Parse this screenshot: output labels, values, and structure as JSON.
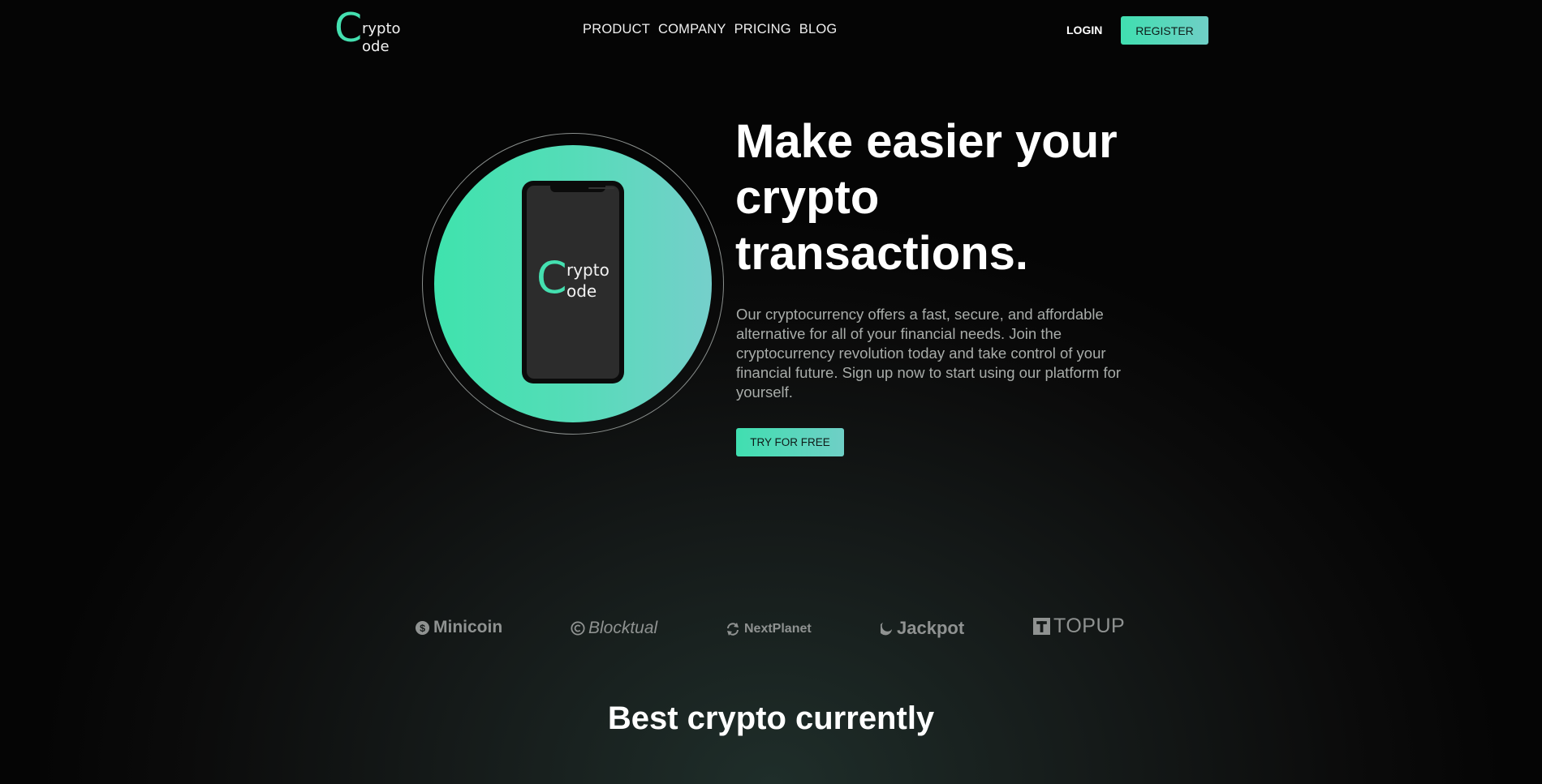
{
  "header": {
    "logo": {
      "big_letter": "C",
      "line1": "rypto",
      "line2": "ode"
    },
    "nav": [
      {
        "label": "PRODUCT"
      },
      {
        "label": "COMPANY"
      },
      {
        "label": "PRICING"
      },
      {
        "label": "BLOG"
      }
    ],
    "login_label": "LOGIN",
    "register_label": "REGISTER"
  },
  "hero": {
    "phone_logo": {
      "big_letter": "C",
      "line1": "rypto",
      "line2": "ode"
    },
    "title_lines": [
      "Make easier your",
      "crypto",
      "transactions."
    ],
    "description": "Our cryptocurrency offers a fast, secure, and affordable alternative for all of your financial needs. Join the cryptocurrency revolution today and take control of your financial future. Sign up now to start using our platform for yourself.",
    "cta_label": "TRY FOR FREE"
  },
  "partners": [
    {
      "name": "Minicoin",
      "icon": "dollar-coin-icon"
    },
    {
      "name": "Blocktual",
      "icon": "copyright-circle-icon"
    },
    {
      "name": "NextPlanet",
      "icon": "refresh-cycle-icon"
    },
    {
      "name": "Jackpot",
      "icon": "crescent-icon"
    },
    {
      "name": "TOPUP",
      "icon": "t-square-icon"
    }
  ],
  "section": {
    "title": "Best crypto currently"
  },
  "colors": {
    "accent": "#44e0b0",
    "accent_end": "#6fcfc6",
    "background": "#0b0b0b"
  }
}
